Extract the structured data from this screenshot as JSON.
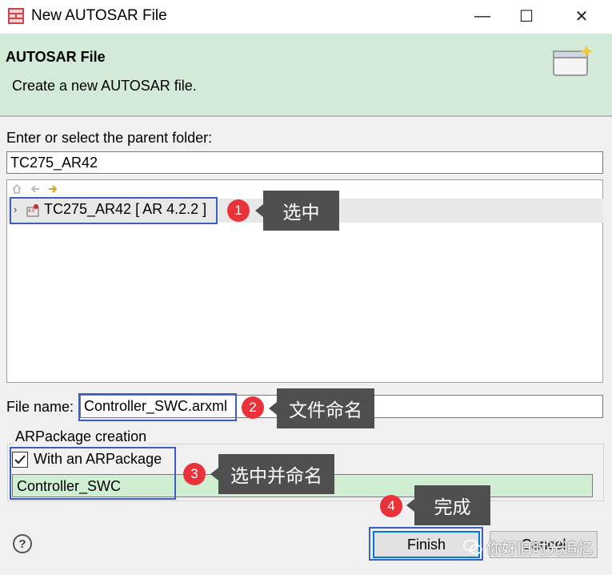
{
  "window": {
    "title": "New AUTOSAR File",
    "minimize": "—",
    "maximize": "☐",
    "close": "✕"
  },
  "banner": {
    "title": "AUTOSAR File",
    "description": "Create a new AUTOSAR file."
  },
  "parent_folder": {
    "label": "Enter or select the parent folder:",
    "value": "TC275_AR42"
  },
  "tree": {
    "items": [
      {
        "label": "TC275_AR42 [ AR 4.2.2 ]",
        "expanded": false
      }
    ]
  },
  "file_name": {
    "label": "File name:",
    "value": "Controller_SWC.arxml"
  },
  "arpackage": {
    "group_label": "ARPackage creation",
    "checkbox_label": "With an ARPackage",
    "checked": true,
    "value": "Controller_SWC"
  },
  "buttons": {
    "help": "?",
    "finish": "Finish",
    "cancel": "Cancel"
  },
  "annotations": [
    {
      "number": "1",
      "text": "选中"
    },
    {
      "number": "2",
      "text": "文件命名"
    },
    {
      "number": "3",
      "text": "选中并命名"
    },
    {
      "number": "4",
      "text": "完成"
    }
  ],
  "watermark": "你好旧时光追忆",
  "colors": {
    "banner_bg": "#d3ead9",
    "badge": "#e8333a",
    "callout": "#4f4f4f",
    "highlight_box": "#3a5fc0"
  }
}
